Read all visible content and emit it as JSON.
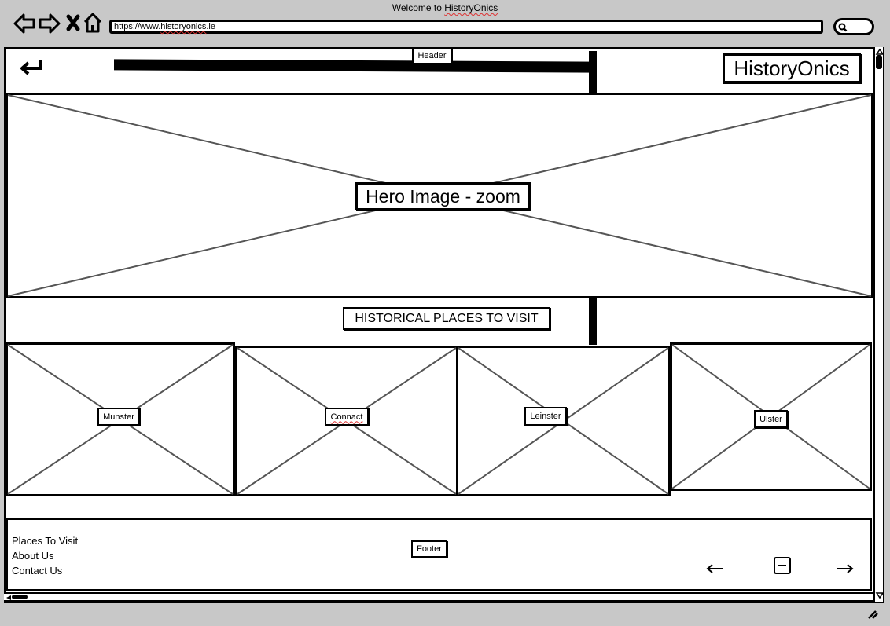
{
  "browser": {
    "title_prefix": "Welcome to ",
    "title_brand": "HistoryOnics",
    "url_prefix": "https://www.",
    "url_brand": "historyonics",
    "url_suffix": ".ie"
  },
  "header": {
    "label": "Header",
    "logo_text": "HistoryOnics"
  },
  "hero": {
    "label": "Hero Image - zoom"
  },
  "section": {
    "title": "HISTORICAL PLACES TO VISIT",
    "provinces": [
      {
        "label": "Munster"
      },
      {
        "label": "Connact"
      },
      {
        "label": "Leinster"
      },
      {
        "label": "Ulster"
      }
    ]
  },
  "footer": {
    "label": "Footer",
    "links": [
      "Places To Visit",
      "About Us",
      "Contact Us"
    ]
  }
}
